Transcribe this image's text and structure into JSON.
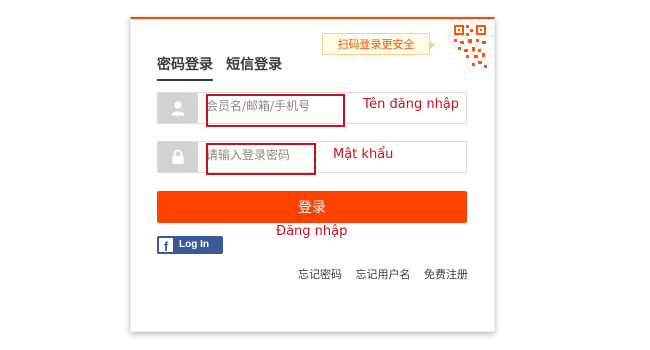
{
  "qr_tip": "扫码登录更安全",
  "tabs": [
    {
      "label": "密码登录",
      "active": true
    },
    {
      "label": "短信登录",
      "active": false
    }
  ],
  "username": {
    "placeholder": "会员名/邮箱/手机号",
    "note": "Tên đăng nhập",
    "icon": "user-icon"
  },
  "password": {
    "placeholder": "请输入登录密码",
    "note": "Mật khẩu",
    "icon": "lock-icon"
  },
  "login_button": {
    "label": "登录",
    "note": "Đăng nhập"
  },
  "facebook": {
    "label": "Log In"
  },
  "links": [
    "忘记密码",
    "忘记用户名",
    "免费注册"
  ],
  "colors": {
    "accent": "#ff4200",
    "annotation": "#c8111a",
    "facebook": "#3b5998"
  }
}
